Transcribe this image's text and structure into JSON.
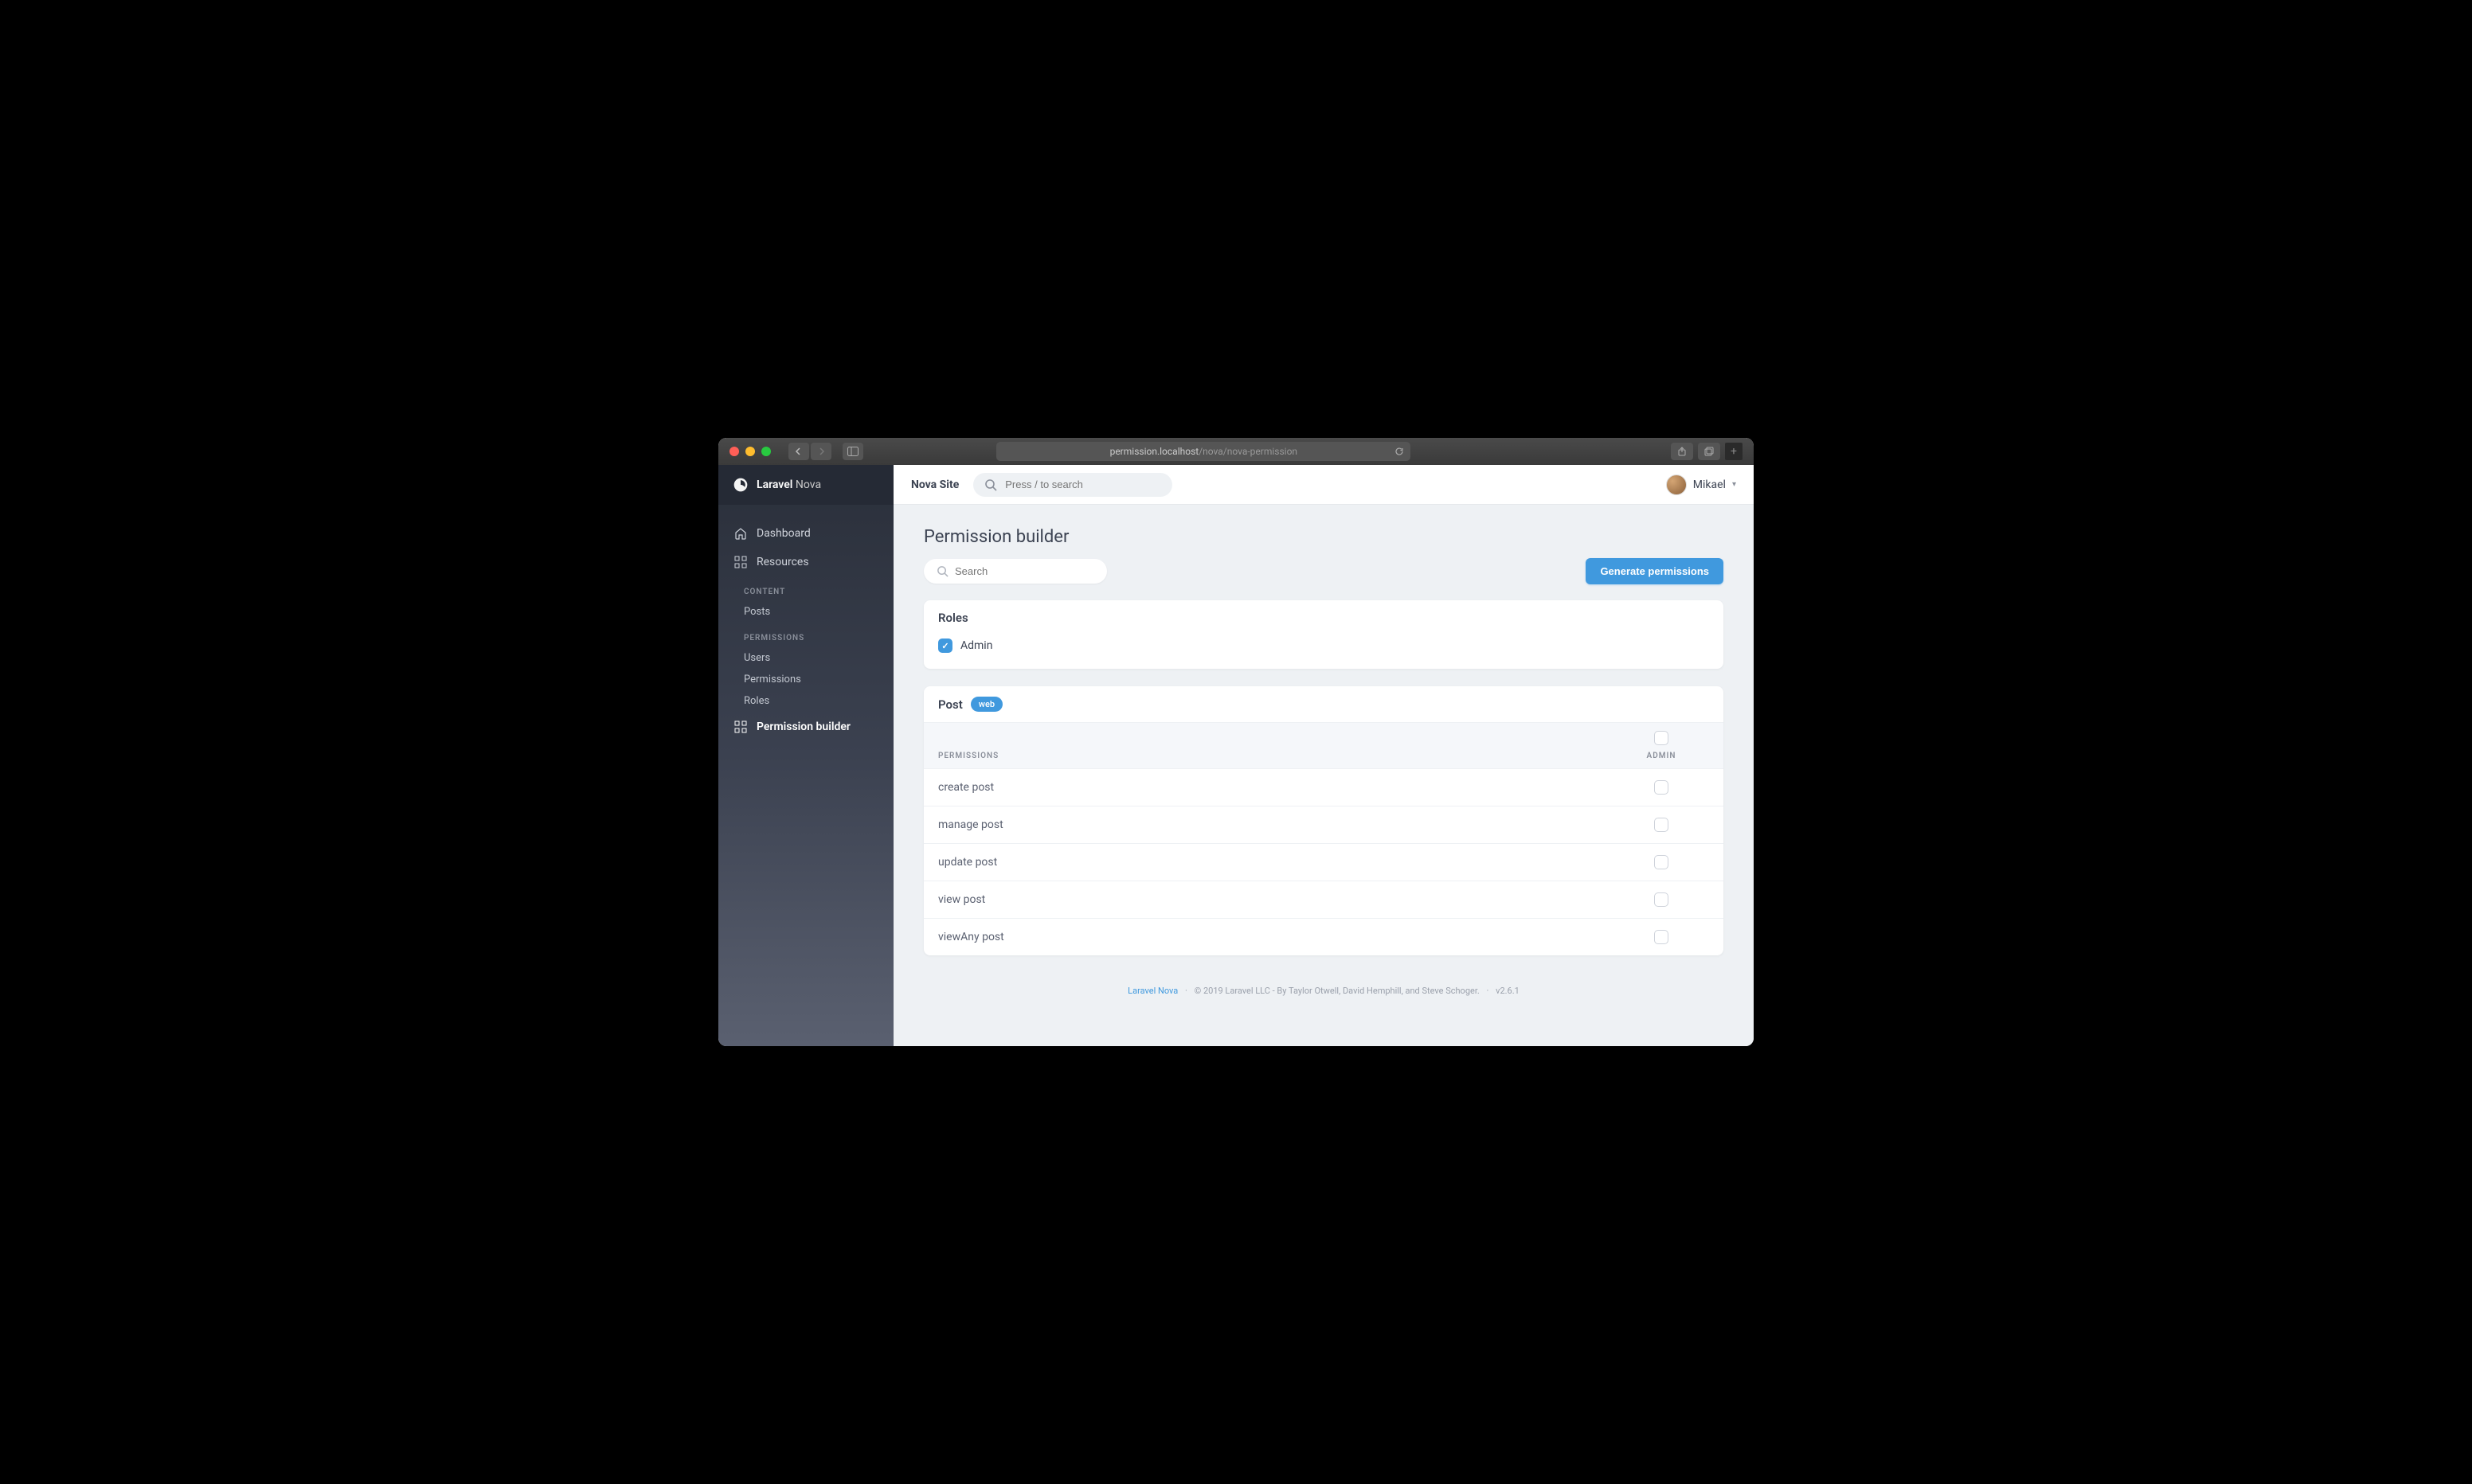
{
  "browser": {
    "url_host": "permission.localhost",
    "url_path": "/nova/nova-permission"
  },
  "brand": {
    "name_bold": "Laravel",
    "name_light": "Nova"
  },
  "sidebar": {
    "dashboard": "Dashboard",
    "resources": "Resources",
    "content_heading": "CONTENT",
    "posts": "Posts",
    "permissions_heading": "PERMISSIONS",
    "users": "Users",
    "permissions": "Permissions",
    "roles": "Roles",
    "permission_builder": "Permission builder"
  },
  "topbar": {
    "site_title": "Nova Site",
    "search_placeholder": "Press / to search",
    "user_name": "Mikael"
  },
  "page": {
    "title": "Permission builder",
    "search_placeholder": "Search",
    "generate_button": "Generate permissions"
  },
  "roles_card": {
    "title": "Roles",
    "roles": [
      {
        "label": "Admin",
        "checked": true
      }
    ]
  },
  "resource_card": {
    "title": "Post",
    "guard": "web",
    "col_permissions": "PERMISSIONS",
    "col_role": "ADMIN",
    "permissions": [
      {
        "name": "create post",
        "checked": false
      },
      {
        "name": "manage post",
        "checked": false
      },
      {
        "name": "update post",
        "checked": false
      },
      {
        "name": "view post",
        "checked": false
      },
      {
        "name": "viewAny post",
        "checked": false
      }
    ]
  },
  "footer": {
    "link": "Laravel Nova",
    "copyright": "© 2019 Laravel LLC - By Taylor Otwell, David Hemphill, and Steve Schoger.",
    "version": "v2.6.1"
  }
}
